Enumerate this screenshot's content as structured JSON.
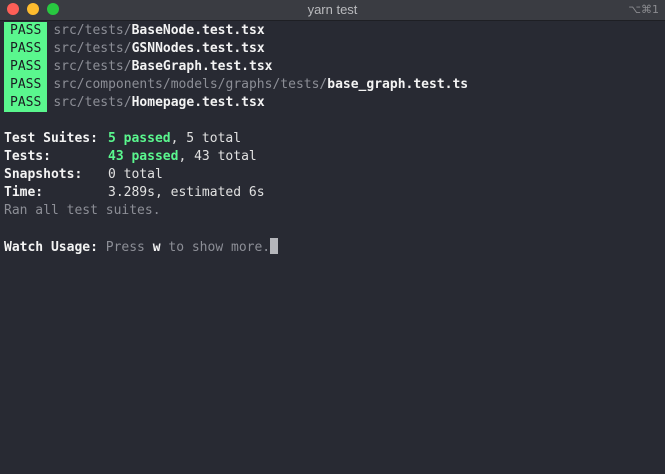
{
  "window": {
    "title": "yarn test",
    "shortcut": "⌥⌘1"
  },
  "results": [
    {
      "status": "PASS",
      "dir": "src/tests/",
      "file": "BaseNode.test.tsx"
    },
    {
      "status": "PASS",
      "dir": "src/tests/",
      "file": "GSNNodes.test.tsx"
    },
    {
      "status": "PASS",
      "dir": "src/tests/",
      "file": "BaseGraph.test.tsx"
    },
    {
      "status": "PASS",
      "dir": "src/components/models/graphs/tests/",
      "file": "base_graph.test.ts"
    },
    {
      "status": "PASS",
      "dir": "src/tests/",
      "file": "Homepage.test.tsx"
    }
  ],
  "summary": {
    "suites": {
      "label": "Test Suites:",
      "passed": "5 passed",
      "rest": ", 5 total"
    },
    "tests": {
      "label": "Tests:",
      "passed": "43 passed",
      "rest": ", 43 total"
    },
    "snapshots": {
      "label": "Snapshots:",
      "value": "0 total"
    },
    "time": {
      "label": "Time:",
      "value": "3.289s, estimated 6s"
    },
    "ran": "Ran all test suites."
  },
  "watch": {
    "label": "Watch Usage:",
    "pre": " Press ",
    "key": "w",
    "post": " to show more."
  },
  "colors": {
    "background": "#282a33",
    "pass_badge": "#5af78e",
    "passed_text": "#5af78e"
  }
}
